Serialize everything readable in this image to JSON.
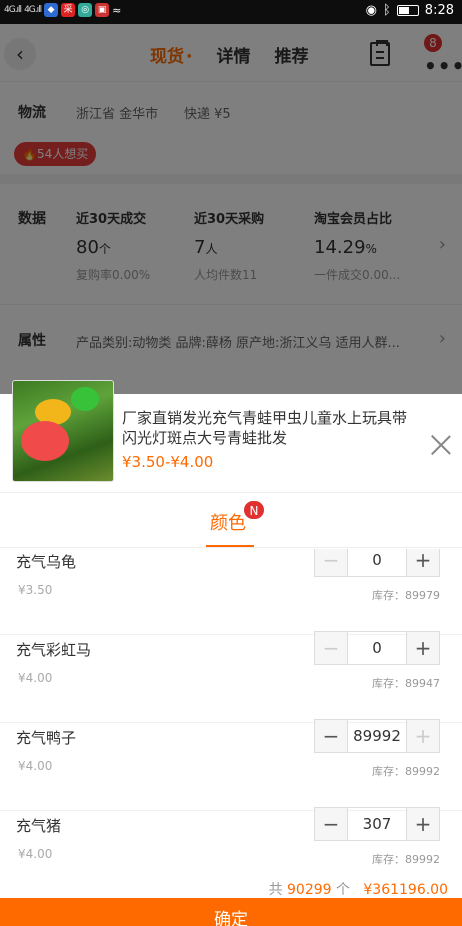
{
  "status_bar": {
    "signal1": "4G.ıll",
    "signal2": "4G.ıll",
    "time": "8:28"
  },
  "nav": {
    "tabs": [
      "现货",
      "详情",
      "推荐"
    ],
    "cart_count": "8"
  },
  "logistics": {
    "label": "物流",
    "location": "浙江省 金华市",
    "shipping": "快递 ¥5"
  },
  "hot_badge": "🔥54人想买",
  "data_section": {
    "label": "数据",
    "stats": [
      {
        "title": "近30天成交",
        "value": "80",
        "unit": "个",
        "sub": "复购率0.00%"
      },
      {
        "title": "近30天采购",
        "value": "7",
        "unit": "人",
        "sub": "人均件数11"
      },
      {
        "title": "淘宝会员占比",
        "value": "14.29",
        "unit": "%",
        "sub": "一件成交0.00..."
      }
    ]
  },
  "attributes": {
    "label": "属性",
    "text": "产品类别:动物类  品牌:薛杨  原产地:浙江义乌  适用人群..."
  },
  "product": {
    "title": "厂家直销发光充气青蛙甲虫儿童水上玩具带闪光灯斑点大号青蛙批发",
    "price": "¥3.50-¥4.00"
  },
  "spec": {
    "tab": "颜色",
    "badge": "N"
  },
  "skus": [
    {
      "name": "充气乌龟",
      "price": "¥3.50",
      "qty": "0",
      "stock": "库存：89979"
    },
    {
      "name": "充气彩虹马",
      "price": "¥4.00",
      "qty": "0",
      "stock": "库存：89947"
    },
    {
      "name": "充气鸭子",
      "price": "¥4.00",
      "qty": "89992",
      "stock": "库存：89992"
    },
    {
      "name": "充气猪",
      "price": "¥4.00",
      "qty": "307",
      "stock": "库存：89992"
    }
  ],
  "summary": {
    "prefix": "共",
    "count": "90299",
    "unit": "个",
    "total": "¥361196.00"
  },
  "confirm_label": "确定",
  "colors": {
    "accent": "#ff6a00",
    "badge": "#e03030"
  }
}
